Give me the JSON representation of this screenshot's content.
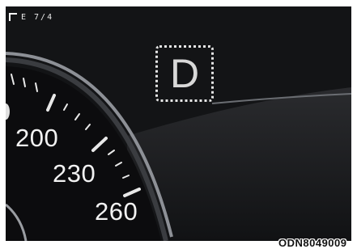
{
  "header": {
    "indicator_label": "E 7/4"
  },
  "gear": {
    "letter": "D"
  },
  "speedometer": {
    "labels": [
      "200",
      "230",
      "260"
    ]
  },
  "figure": {
    "code": "ODN8049009"
  }
}
